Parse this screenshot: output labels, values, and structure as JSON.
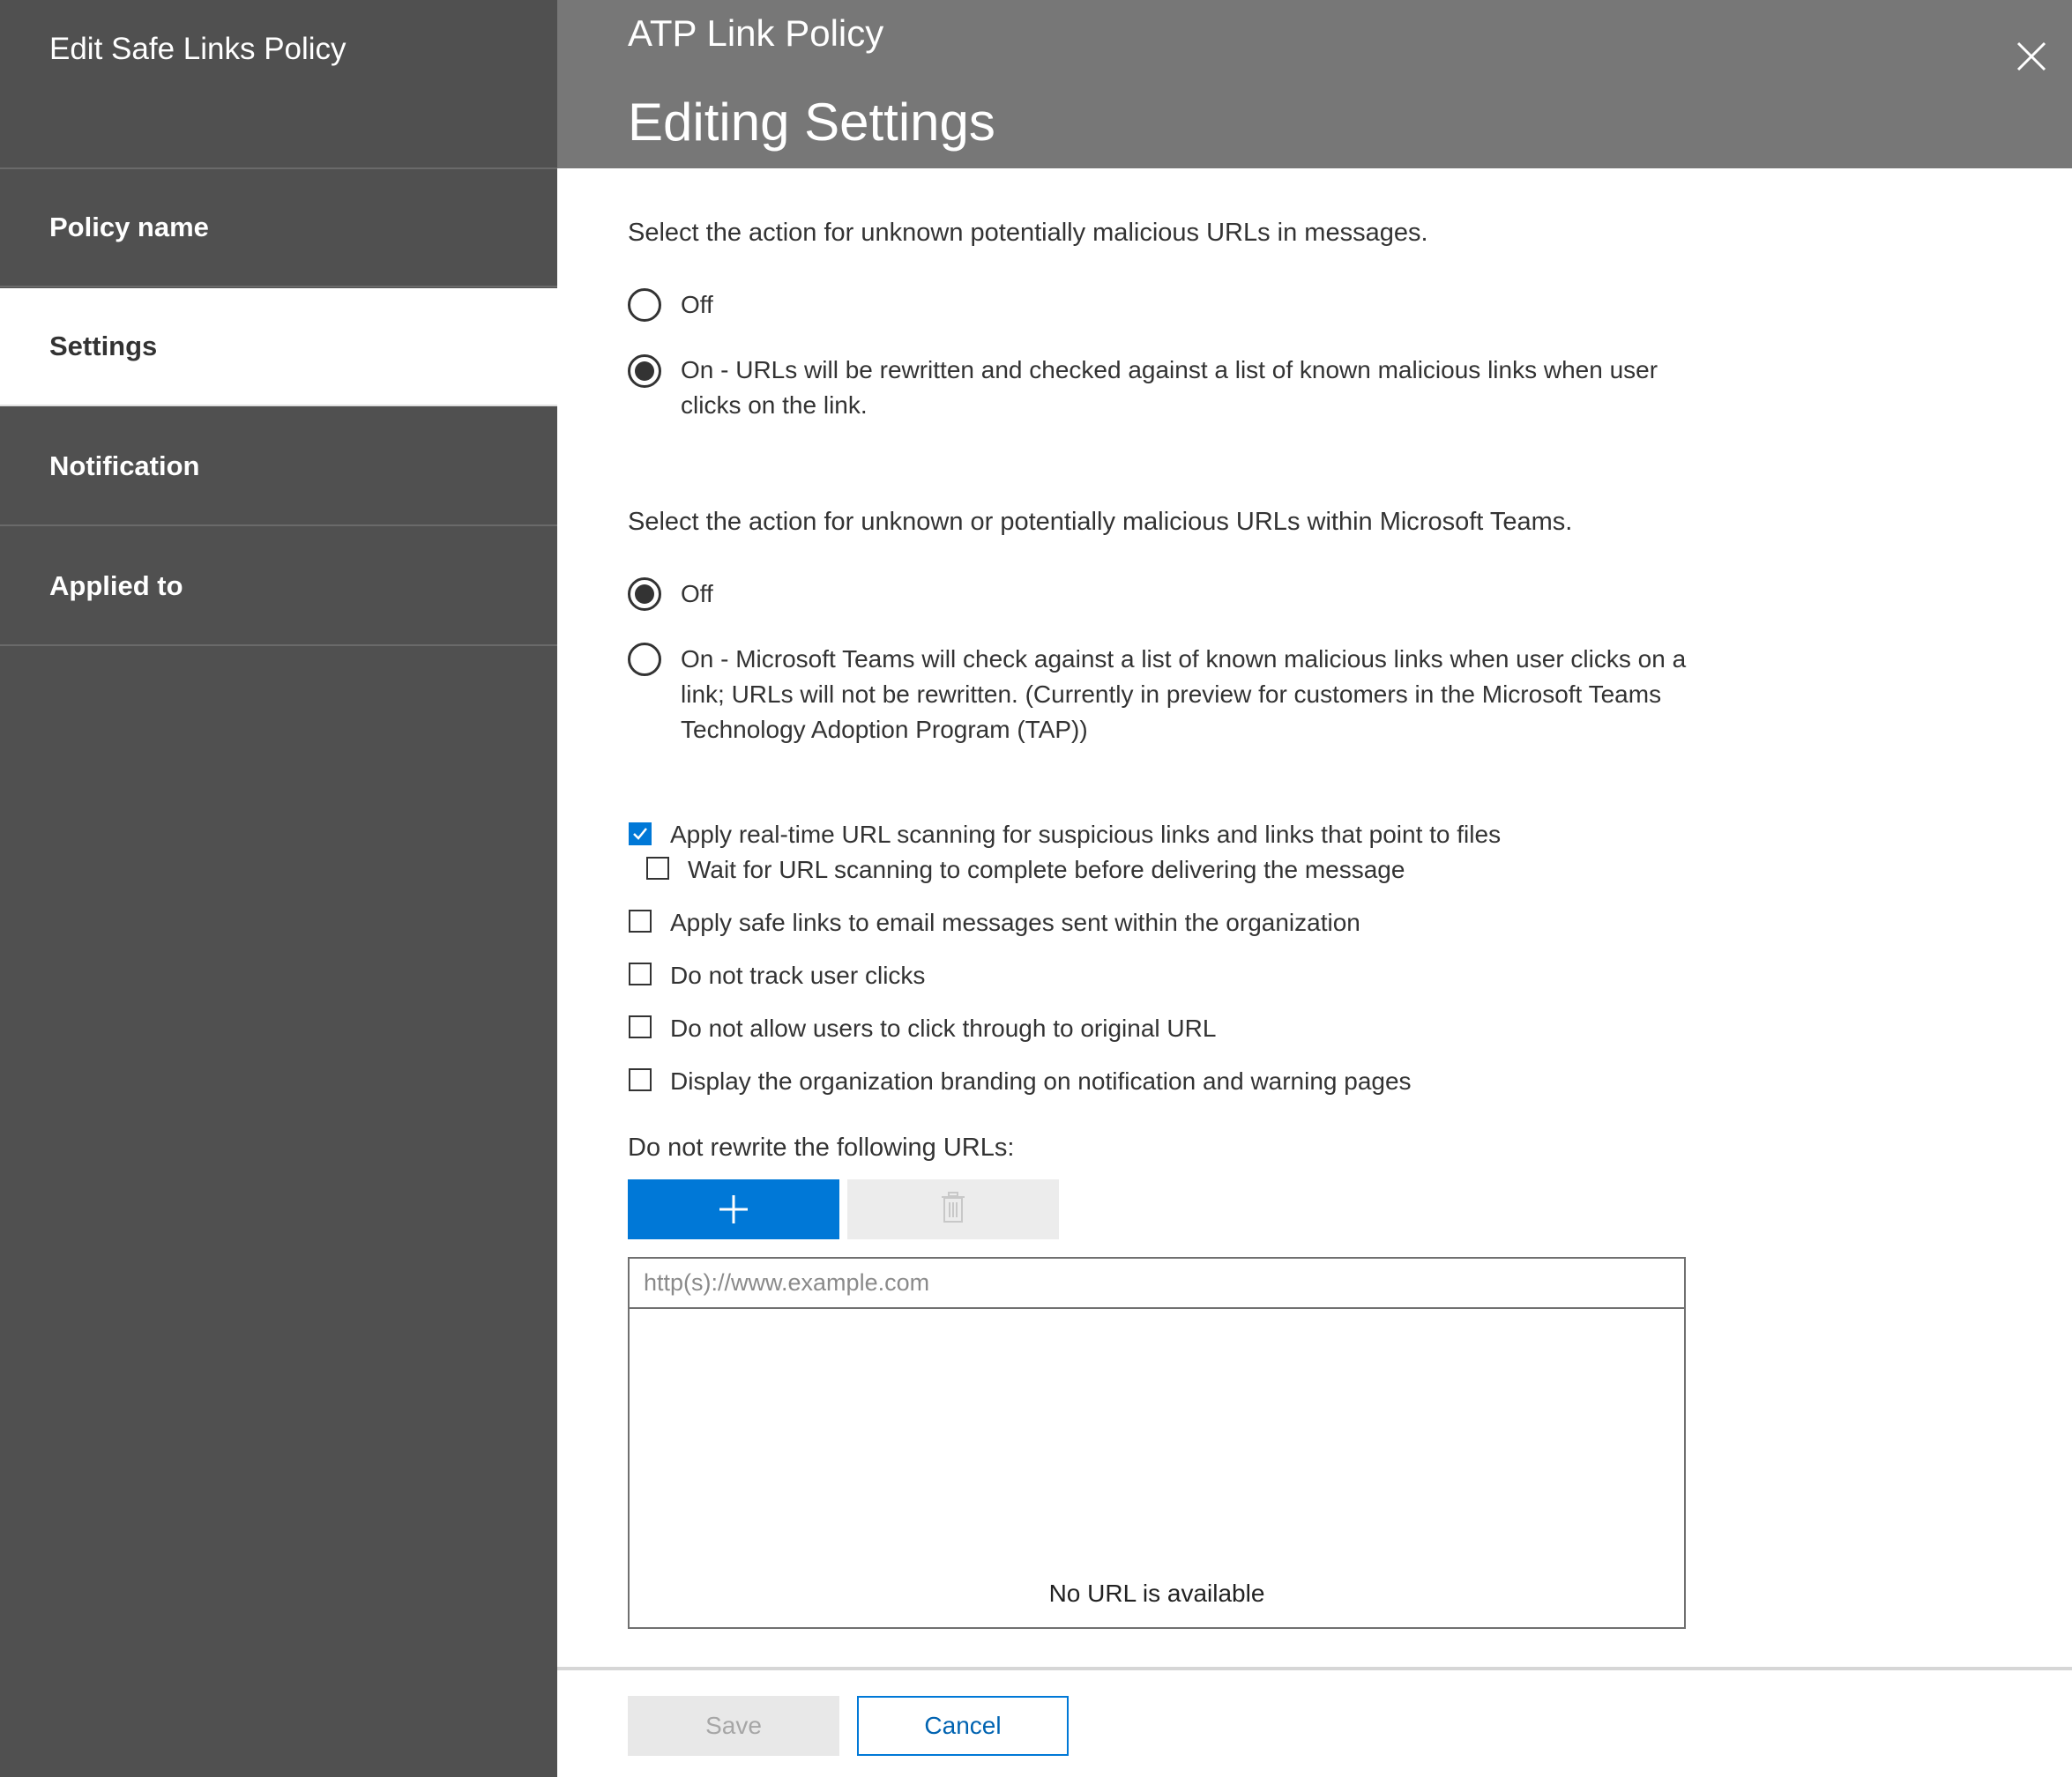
{
  "sidebar": {
    "title": "Edit Safe Links Policy",
    "items": [
      {
        "label": "Policy name",
        "active": false
      },
      {
        "label": "Settings",
        "active": true
      },
      {
        "label": "Notification",
        "active": false
      },
      {
        "label": "Applied to",
        "active": false
      }
    ]
  },
  "header": {
    "subtitle": "ATP Link Policy",
    "title": "Editing Settings",
    "close_icon": "close-icon"
  },
  "messages_section": {
    "label": "Select the action for unknown potentially malicious URLs in messages.",
    "options": [
      {
        "label": "Off",
        "checked": false
      },
      {
        "label": "On - URLs will be rewritten and checked against a list of known malicious links when user clicks on the link.",
        "checked": true
      }
    ]
  },
  "teams_section": {
    "label": "Select the action for unknown or potentially malicious URLs within Microsoft Teams.",
    "options": [
      {
        "label": "Off",
        "checked": true
      },
      {
        "label": "On - Microsoft Teams will check against a list of known malicious links when user clicks on a link; URLs will not be rewritten. (Currently in preview for customers in the Microsoft Teams Technology Adoption Program (TAP))",
        "checked": false
      }
    ]
  },
  "checkboxes": [
    {
      "label": "Apply real-time URL scanning for suspicious links and links that point to files",
      "checked": true
    },
    {
      "label": "Wait for URL scanning to complete before delivering the message",
      "checked": false
    },
    {
      "label": "Apply safe links to email messages sent within the organization",
      "checked": false
    },
    {
      "label": "Do not track user clicks",
      "checked": false
    },
    {
      "label": "Do not allow users to click through to original URL",
      "checked": false
    },
    {
      "label": "Display the organization branding on notification and warning pages",
      "checked": false
    }
  ],
  "urls": {
    "label": "Do not rewrite the following URLs:",
    "add_icon": "plus-icon",
    "delete_icon": "trash-icon",
    "input_placeholder": "http(s)://www.example.com",
    "input_value": "",
    "empty_text": "No URL is available"
  },
  "footer": {
    "save_label": "Save",
    "cancel_label": "Cancel"
  },
  "colors": {
    "sidebar_bg": "#505050",
    "header_bg": "#777777",
    "accent": "#0078d7"
  }
}
